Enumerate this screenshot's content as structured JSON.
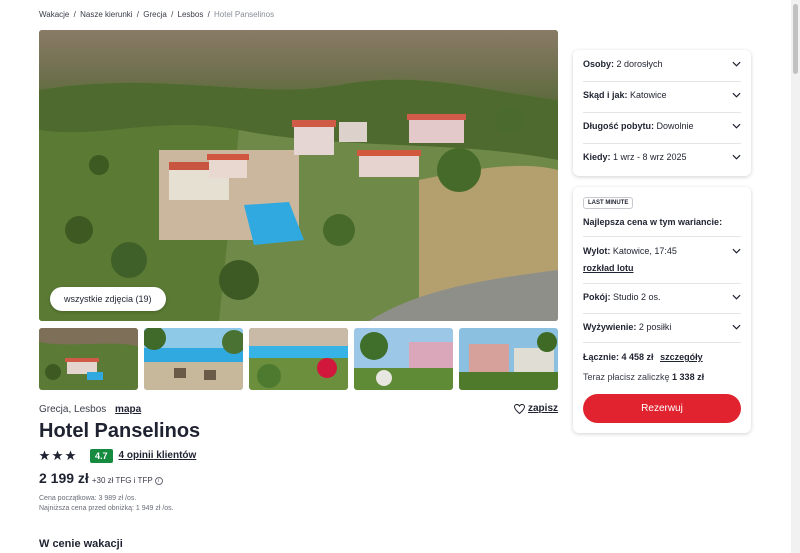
{
  "breadcrumb": {
    "items": [
      "Wakacje",
      "Nasze kierunki",
      "Grecja",
      "Lesbos"
    ],
    "current": "Hotel Panselinos",
    "separator": "/"
  },
  "gallery": {
    "all_photos_label": "wszystkie zdjęcia (19)"
  },
  "hotel": {
    "location": "Grecja, Lesbos",
    "map_label": "mapa",
    "save_label": "zapisz",
    "name": "Hotel Panselinos",
    "stars": 3,
    "score": "4.7",
    "reviews_label": "4 opinii klientów",
    "price": "2 199 zł",
    "tfg_label": "+30 zł TFG i TFP",
    "initial_price_label": "Cena początkowa: 3 989 zł /os.",
    "lowest_price_label": "Najniższa cena przed obniżką: 1 949 zł /os.",
    "section_title": "W cenie wakacji"
  },
  "search_card": {
    "rows": [
      {
        "label": "Osoby:",
        "value": "2 dorosłych"
      },
      {
        "label": "Skąd i jak:",
        "value": "Katowice"
      },
      {
        "label": "Długość pobytu:",
        "value": "Dowolnie"
      },
      {
        "label": "Kiedy:",
        "value": "1 wrz - 8 wrz 2025"
      }
    ]
  },
  "offer_card": {
    "badge": "LAST MINUTE",
    "heading": "Najlepsza cena w tym wariancie:",
    "flight_label": "Wylot:",
    "flight_value": "Katowice, 17:45",
    "flight_link": "rozkład lotu",
    "room_label": "Pokój:",
    "room_value": "Studio 2 os.",
    "board_label": "Wyżywienie:",
    "board_value": "2 posiłki",
    "total_label": "Łącznie:",
    "total_value": "4 458 zł",
    "details_label": "szczegóły",
    "deposit_prefix": "Teraz płacisz zaliczkę",
    "deposit_value": "1 338 zł",
    "book_label": "Rezerwuj"
  },
  "colors": {
    "accent": "#e0232e",
    "rating": "#168a3f",
    "text": "#1f2230"
  }
}
